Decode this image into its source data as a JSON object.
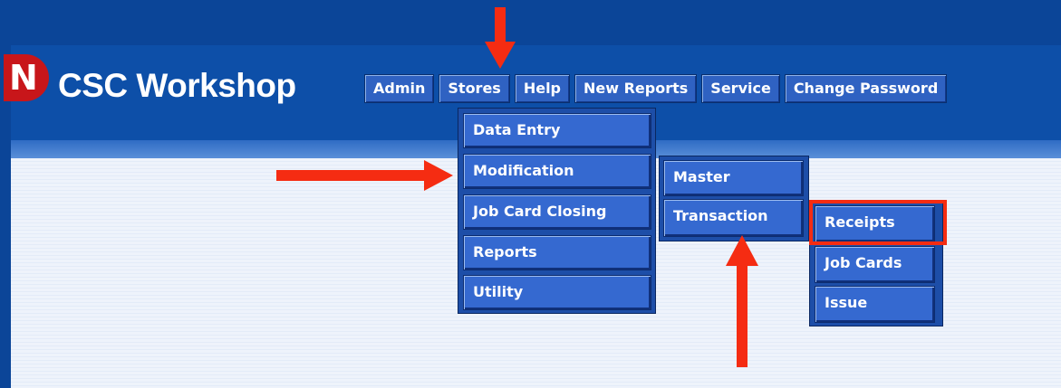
{
  "app": {
    "title": "CSC Workshop",
    "logo_letter": "N"
  },
  "menubar": {
    "items": [
      "Admin",
      "Stores",
      "Help",
      "New Reports",
      "Service",
      "Change Password"
    ]
  },
  "stores_menu": {
    "items": [
      "Data Entry",
      "Modification",
      "Job Card Closing",
      "Reports",
      "Utility"
    ]
  },
  "modification_menu": {
    "items": [
      "Master",
      "Transaction"
    ]
  },
  "transaction_menu": {
    "items": [
      "Receipts",
      "Job Cards",
      "Issue"
    ]
  },
  "annotations": {
    "arrow_color": "#f52c12",
    "highlighted_item": "Receipts"
  }
}
